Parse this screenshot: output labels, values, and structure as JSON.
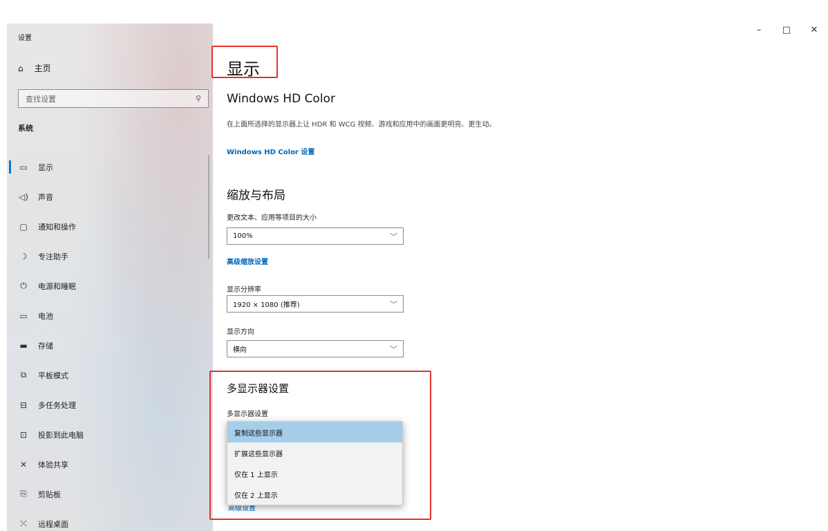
{
  "window": {
    "title": "设置",
    "minimize_icon": "minimize-icon",
    "maximize_icon": "maximize-icon",
    "close_icon": "close-icon"
  },
  "sidebar": {
    "home_label": "主页",
    "search_placeholder": "查找设置",
    "section_label": "系统",
    "items": [
      {
        "label": "显示",
        "icon": "monitor-icon",
        "active": true
      },
      {
        "label": "声音",
        "icon": "speaker-icon"
      },
      {
        "label": "通知和操作",
        "icon": "notification-icon"
      },
      {
        "label": "专注助手",
        "icon": "moon-icon"
      },
      {
        "label": "电源和睡眠",
        "icon": "power-icon"
      },
      {
        "label": "电池",
        "icon": "battery-icon"
      },
      {
        "label": "存储",
        "icon": "storage-icon"
      },
      {
        "label": "平板模式",
        "icon": "tablet-icon"
      },
      {
        "label": "多任务处理",
        "icon": "multitask-icon"
      },
      {
        "label": "投影到此电脑",
        "icon": "project-icon"
      },
      {
        "label": "体验共享",
        "icon": "share-icon"
      },
      {
        "label": "剪贴板",
        "icon": "clipboard-icon"
      },
      {
        "label": "远程桌面",
        "icon": "remote-desktop-icon"
      }
    ]
  },
  "main": {
    "title": "显示",
    "hdr": {
      "heading": "Windows HD Color",
      "description": "在上面所选择的显示器上让 HDR 和 WCG 视频、游戏和应用中的画面更明亮、更生动。",
      "link": "Windows HD Color 设置"
    },
    "scale": {
      "heading": "缩放与布局",
      "size_label": "更改文本、应用等项目的大小",
      "size_value": "100%",
      "advanced_link": "高级缩放设置",
      "resolution_label": "显示分辨率",
      "resolution_value": "1920 × 1080 (推荐)",
      "orientation_label": "显示方向",
      "orientation_value": "横向"
    },
    "multi": {
      "heading": "多显示器设置",
      "label": "多显示器设置",
      "options": [
        "复制这些显示器",
        "扩展这些显示器",
        "仅在 1 上显示",
        "仅在 2 上显示"
      ],
      "selected_index": 0,
      "cut_link": "高级设置"
    }
  },
  "colors": {
    "accent": "#0078d7",
    "link": "#0067b8",
    "highlight": "#e23030",
    "selected_option": "#a6cdea"
  }
}
